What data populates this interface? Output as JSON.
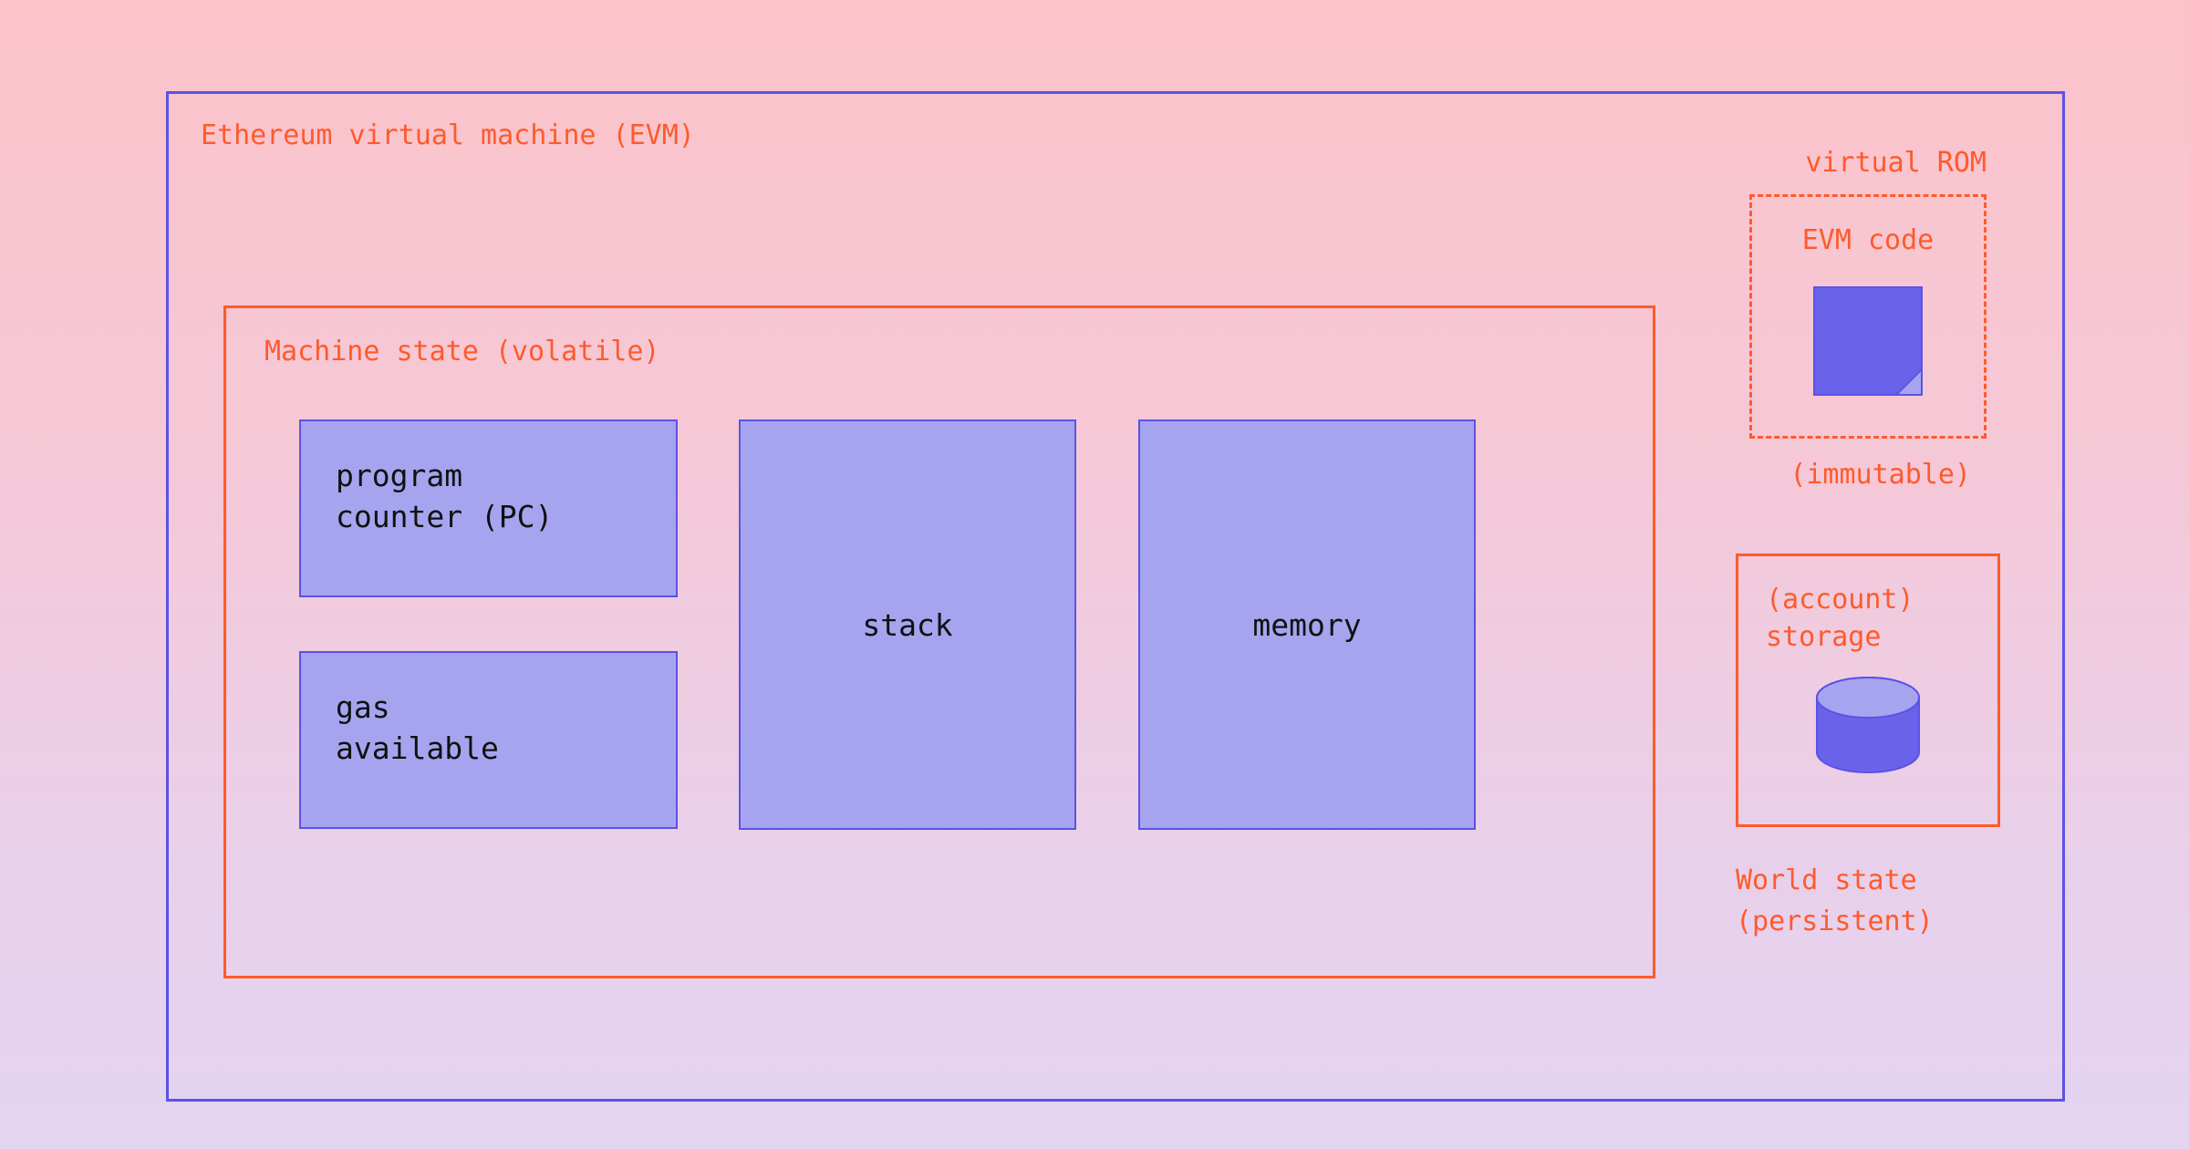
{
  "evm": {
    "title": "Ethereum virtual machine (EVM)",
    "machine_state": {
      "title": "Machine state (volatile)",
      "pc_line1": "program",
      "pc_line2": "counter (PC)",
      "gas_line1": "gas",
      "gas_line2": "available",
      "stack": "stack",
      "memory": "memory"
    },
    "virtual_rom": {
      "label": "virtual ROM",
      "code_label": "EVM code",
      "immutable": "(immutable)"
    },
    "storage": {
      "line1": "(account)",
      "line2": "storage"
    },
    "world_state": {
      "line1": "World state",
      "line2": "(persistent)"
    }
  }
}
